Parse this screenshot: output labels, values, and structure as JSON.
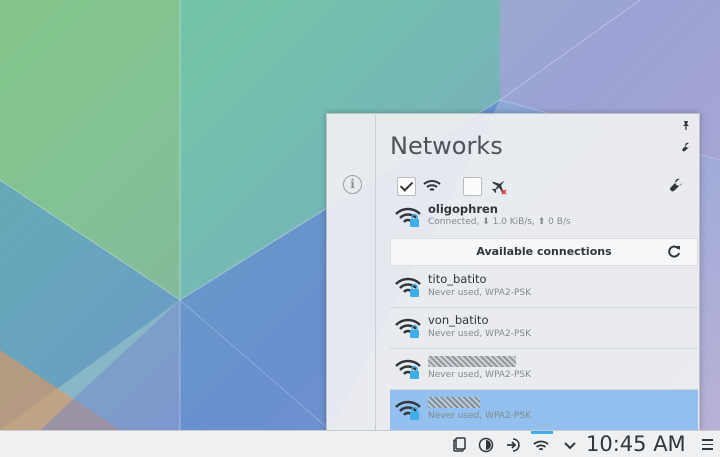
{
  "popup": {
    "title": "Networks",
    "pin_icon": "pin-icon",
    "config_icon": "wrench-icon",
    "info_icon": "info-icon",
    "toolbar": {
      "wifi_enabled": true,
      "airplane_mode": false,
      "wifi_icon": "wifi-icon",
      "airplane_icon": "airplane-icon",
      "settings_icon": "wrench-icon"
    },
    "active_connection": {
      "name": "oligophren",
      "status": "Connected, ⬇ 1.0 KiB/s, ⬆ 0 B/s",
      "icon": "wifi-secured-icon"
    },
    "available_header": "Available connections",
    "refresh_icon": "refresh-icon",
    "networks": [
      {
        "name": "tito_batito",
        "status": "Never used, WPA2-PSK",
        "blurred": false,
        "selected": false
      },
      {
        "name": "von_batito",
        "status": "Never used, WPA2-PSK",
        "blurred": false,
        "selected": false
      },
      {
        "name": "",
        "status": "Never used, WPA2-PSK",
        "blurred": true,
        "selected": false
      },
      {
        "name": "",
        "status": "Never used, WPA2-PSK",
        "blurred": true,
        "selected": true
      }
    ]
  },
  "panel": {
    "clock": "10:45 AM",
    "tray_icons": [
      "clipboard-icon",
      "updates-icon",
      "device-notifier-icon",
      "network-icon",
      "expand-tray-icon"
    ],
    "menu_icon": "hamburger-menu-icon",
    "accent": "#3daee9"
  }
}
